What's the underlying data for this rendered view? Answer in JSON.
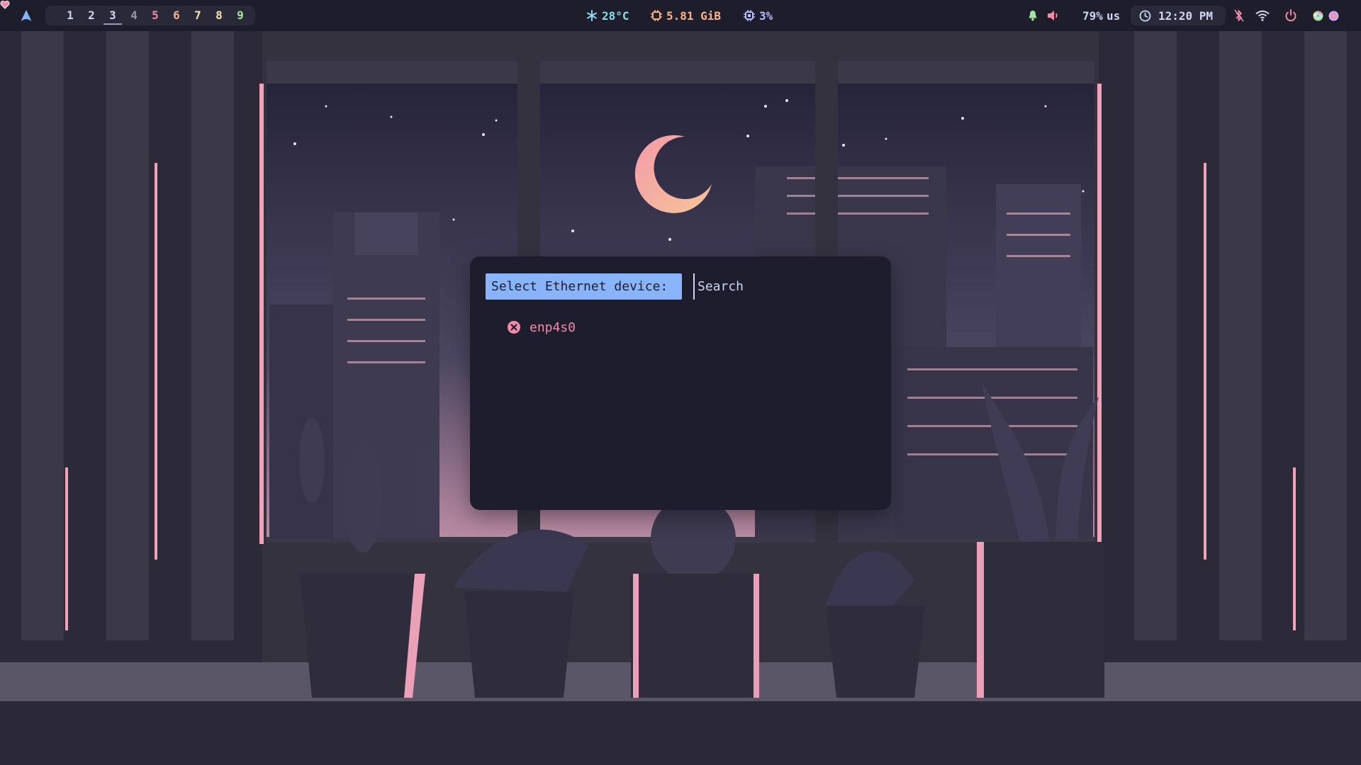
{
  "topbar": {
    "corner_icon": "heart-icon",
    "logo_icon": "arch-logo-icon",
    "workspaces": [
      {
        "label": "1",
        "color": "#cdd6f4"
      },
      {
        "label": "2",
        "color": "#cdd6f4"
      },
      {
        "label": "3",
        "color": "#cdd6f4",
        "active": true
      },
      {
        "label": "4",
        "color": "#9399b2"
      },
      {
        "label": "5",
        "color": "#f38ba8"
      },
      {
        "label": "6",
        "color": "#fab387"
      },
      {
        "label": "7",
        "color": "#f9e2af"
      },
      {
        "label": "8",
        "color": "#f9e2af"
      },
      {
        "label": "9",
        "color": "#a6e3a1"
      }
    ],
    "temperature": "28°C",
    "memory": "5.81 GiB",
    "cpu": "3%",
    "volume": "79%",
    "keyboard_layout": "us",
    "clock": "12:20 PM"
  },
  "dialog": {
    "prompt": "Select Ethernet device:",
    "search_placeholder": "Search",
    "entries": [
      {
        "label": "enp4s0",
        "icon": "close-circle-icon"
      }
    ]
  },
  "colors": {
    "bar_bg": "#1e1d2b",
    "accent_blue": "#89b4fa",
    "accent_pink": "#f38ba8",
    "accent_peach": "#fab387",
    "text": "#cdd6f4",
    "dialog_bg": "#1e1d2d"
  }
}
